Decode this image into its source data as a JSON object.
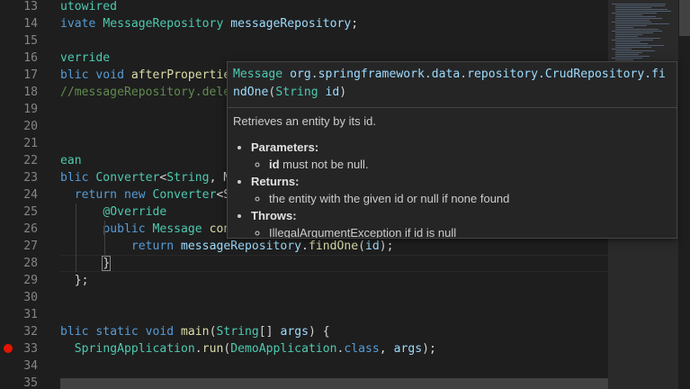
{
  "editor": {
    "lines": [
      {
        "num": "13",
        "tokens": [
          [
            "utowired",
            "t-dec"
          ]
        ]
      },
      {
        "num": "14",
        "tokens": [
          [
            "ivate ",
            "t-kw"
          ],
          [
            "MessageRepository",
            "t-type"
          ],
          [
            " ",
            "t-plain"
          ],
          [
            "messageRepository",
            "t-var"
          ],
          [
            ";",
            "t-plain"
          ]
        ]
      },
      {
        "num": "15",
        "tokens": []
      },
      {
        "num": "16",
        "tokens": [
          [
            "verride",
            "t-dec"
          ]
        ]
      },
      {
        "num": "17",
        "tokens": [
          [
            "blic ",
            "t-kw"
          ],
          [
            "void ",
            "t-kw"
          ],
          [
            "afterPropertie",
            "t-fn"
          ]
        ]
      },
      {
        "num": "18",
        "tokens": [
          [
            "//messageRepository.dele",
            "t-cm"
          ]
        ]
      },
      {
        "num": "19",
        "tokens": []
      },
      {
        "num": "20",
        "tokens": []
      },
      {
        "num": "21",
        "tokens": []
      },
      {
        "num": "22",
        "tokens": [
          [
            "ean",
            "t-dec"
          ]
        ]
      },
      {
        "num": "23",
        "tokens": [
          [
            "blic ",
            "t-kw"
          ],
          [
            "Converter",
            "t-type"
          ],
          [
            "<",
            "t-plain"
          ],
          [
            "String",
            "t-type"
          ],
          [
            ", M",
            "t-plain"
          ]
        ]
      },
      {
        "num": "24",
        "tokens": [
          [
            "  return ",
            "t-kw"
          ],
          [
            "new ",
            "t-kw"
          ],
          [
            "Converter",
            "t-type"
          ],
          [
            "<S",
            "t-plain"
          ]
        ]
      },
      {
        "num": "25",
        "tokens": [
          [
            "      ",
            "t-plain"
          ],
          [
            "@Override",
            "t-dec"
          ]
        ]
      },
      {
        "num": "26",
        "tokens": [
          [
            "      ",
            "t-plain"
          ],
          [
            "public ",
            "t-kw"
          ],
          [
            "Message ",
            "t-type"
          ],
          [
            "con",
            "t-fn"
          ]
        ]
      },
      {
        "num": "27",
        "tokens": [
          [
            "          ",
            "t-plain"
          ],
          [
            "return ",
            "t-kw"
          ],
          [
            "messageRepository",
            "t-var"
          ],
          [
            ".",
            "t-plain"
          ],
          [
            "findOne",
            "t-fn"
          ],
          [
            "(",
            "t-plain"
          ],
          [
            "id",
            "t-var"
          ],
          [
            ");",
            "t-plain"
          ]
        ]
      },
      {
        "num": "28",
        "tokens": [
          [
            "      ",
            "t-plain"
          ],
          [
            "}",
            "t-plain"
          ]
        ]
      },
      {
        "num": "29",
        "tokens": [
          [
            "  };",
            "t-plain"
          ]
        ]
      },
      {
        "num": "30",
        "tokens": []
      },
      {
        "num": "31",
        "tokens": []
      },
      {
        "num": "32",
        "tokens": [
          [
            "blic ",
            "t-kw"
          ],
          [
            "static ",
            "t-kw"
          ],
          [
            "void ",
            "t-kw"
          ],
          [
            "main",
            "t-fn"
          ],
          [
            "(",
            "t-plain"
          ],
          [
            "String",
            "t-type"
          ],
          [
            "[] ",
            "t-plain"
          ],
          [
            "args",
            "t-var"
          ],
          [
            ") {",
            "t-plain"
          ]
        ]
      },
      {
        "num": "33",
        "tokens": [
          [
            "  ",
            "t-plain"
          ],
          [
            "SpringApplication",
            "t-type"
          ],
          [
            ".",
            "t-plain"
          ],
          [
            "run",
            "t-fn"
          ],
          [
            "(",
            "t-plain"
          ],
          [
            "DemoApplication",
            "t-type"
          ],
          [
            ".",
            "t-plain"
          ],
          [
            "class",
            "t-kw"
          ],
          [
            ", ",
            "t-plain"
          ],
          [
            "args",
            "t-var"
          ],
          [
            ");",
            "t-plain"
          ]
        ],
        "breakpoint": true
      },
      {
        "num": "34",
        "tokens": []
      },
      {
        "num": "35",
        "tokens": []
      }
    ]
  },
  "hover": {
    "signature_type": "Message",
    "signature_path": "org.springframework.data.repository.CrudRepository.findOne",
    "signature_open": "(",
    "signature_param_type": "String",
    "signature_param_name": "id",
    "signature_close": ")",
    "description": "Retrieves an entity by its id.",
    "sections": [
      {
        "title": "Parameters:",
        "items": [
          {
            "bold": "id",
            "text": " must not be null."
          }
        ]
      },
      {
        "title": "Returns:",
        "items": [
          {
            "bold": "",
            "text": "the entity with the given id or null if none found"
          }
        ]
      },
      {
        "title": "Throws:",
        "items": [
          {
            "bold": "",
            "text": "IllegalArgumentException if id is null"
          }
        ]
      }
    ]
  },
  "colors": {
    "background": "#1e1e1e",
    "breakpoint": "#e51400",
    "hover_background": "#252526"
  }
}
